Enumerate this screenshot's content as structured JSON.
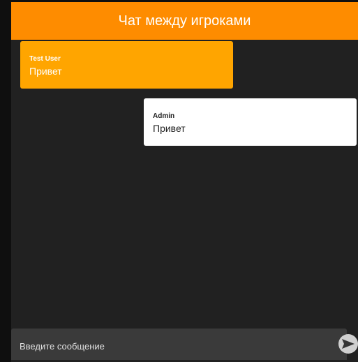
{
  "header": {
    "title": "Чат между игроками"
  },
  "messages": [
    {
      "author": "Test User",
      "text": "Привет"
    },
    {
      "author": "Admin",
      "text": "Привет"
    }
  ],
  "composer": {
    "placeholder": "Введите сообщение",
    "send_icon": "send-icon"
  },
  "colors": {
    "accent": "#fe8c00",
    "incoming_bubble": "#ffa500",
    "outgoing_bubble": "#ffffff",
    "background": "#212121"
  }
}
